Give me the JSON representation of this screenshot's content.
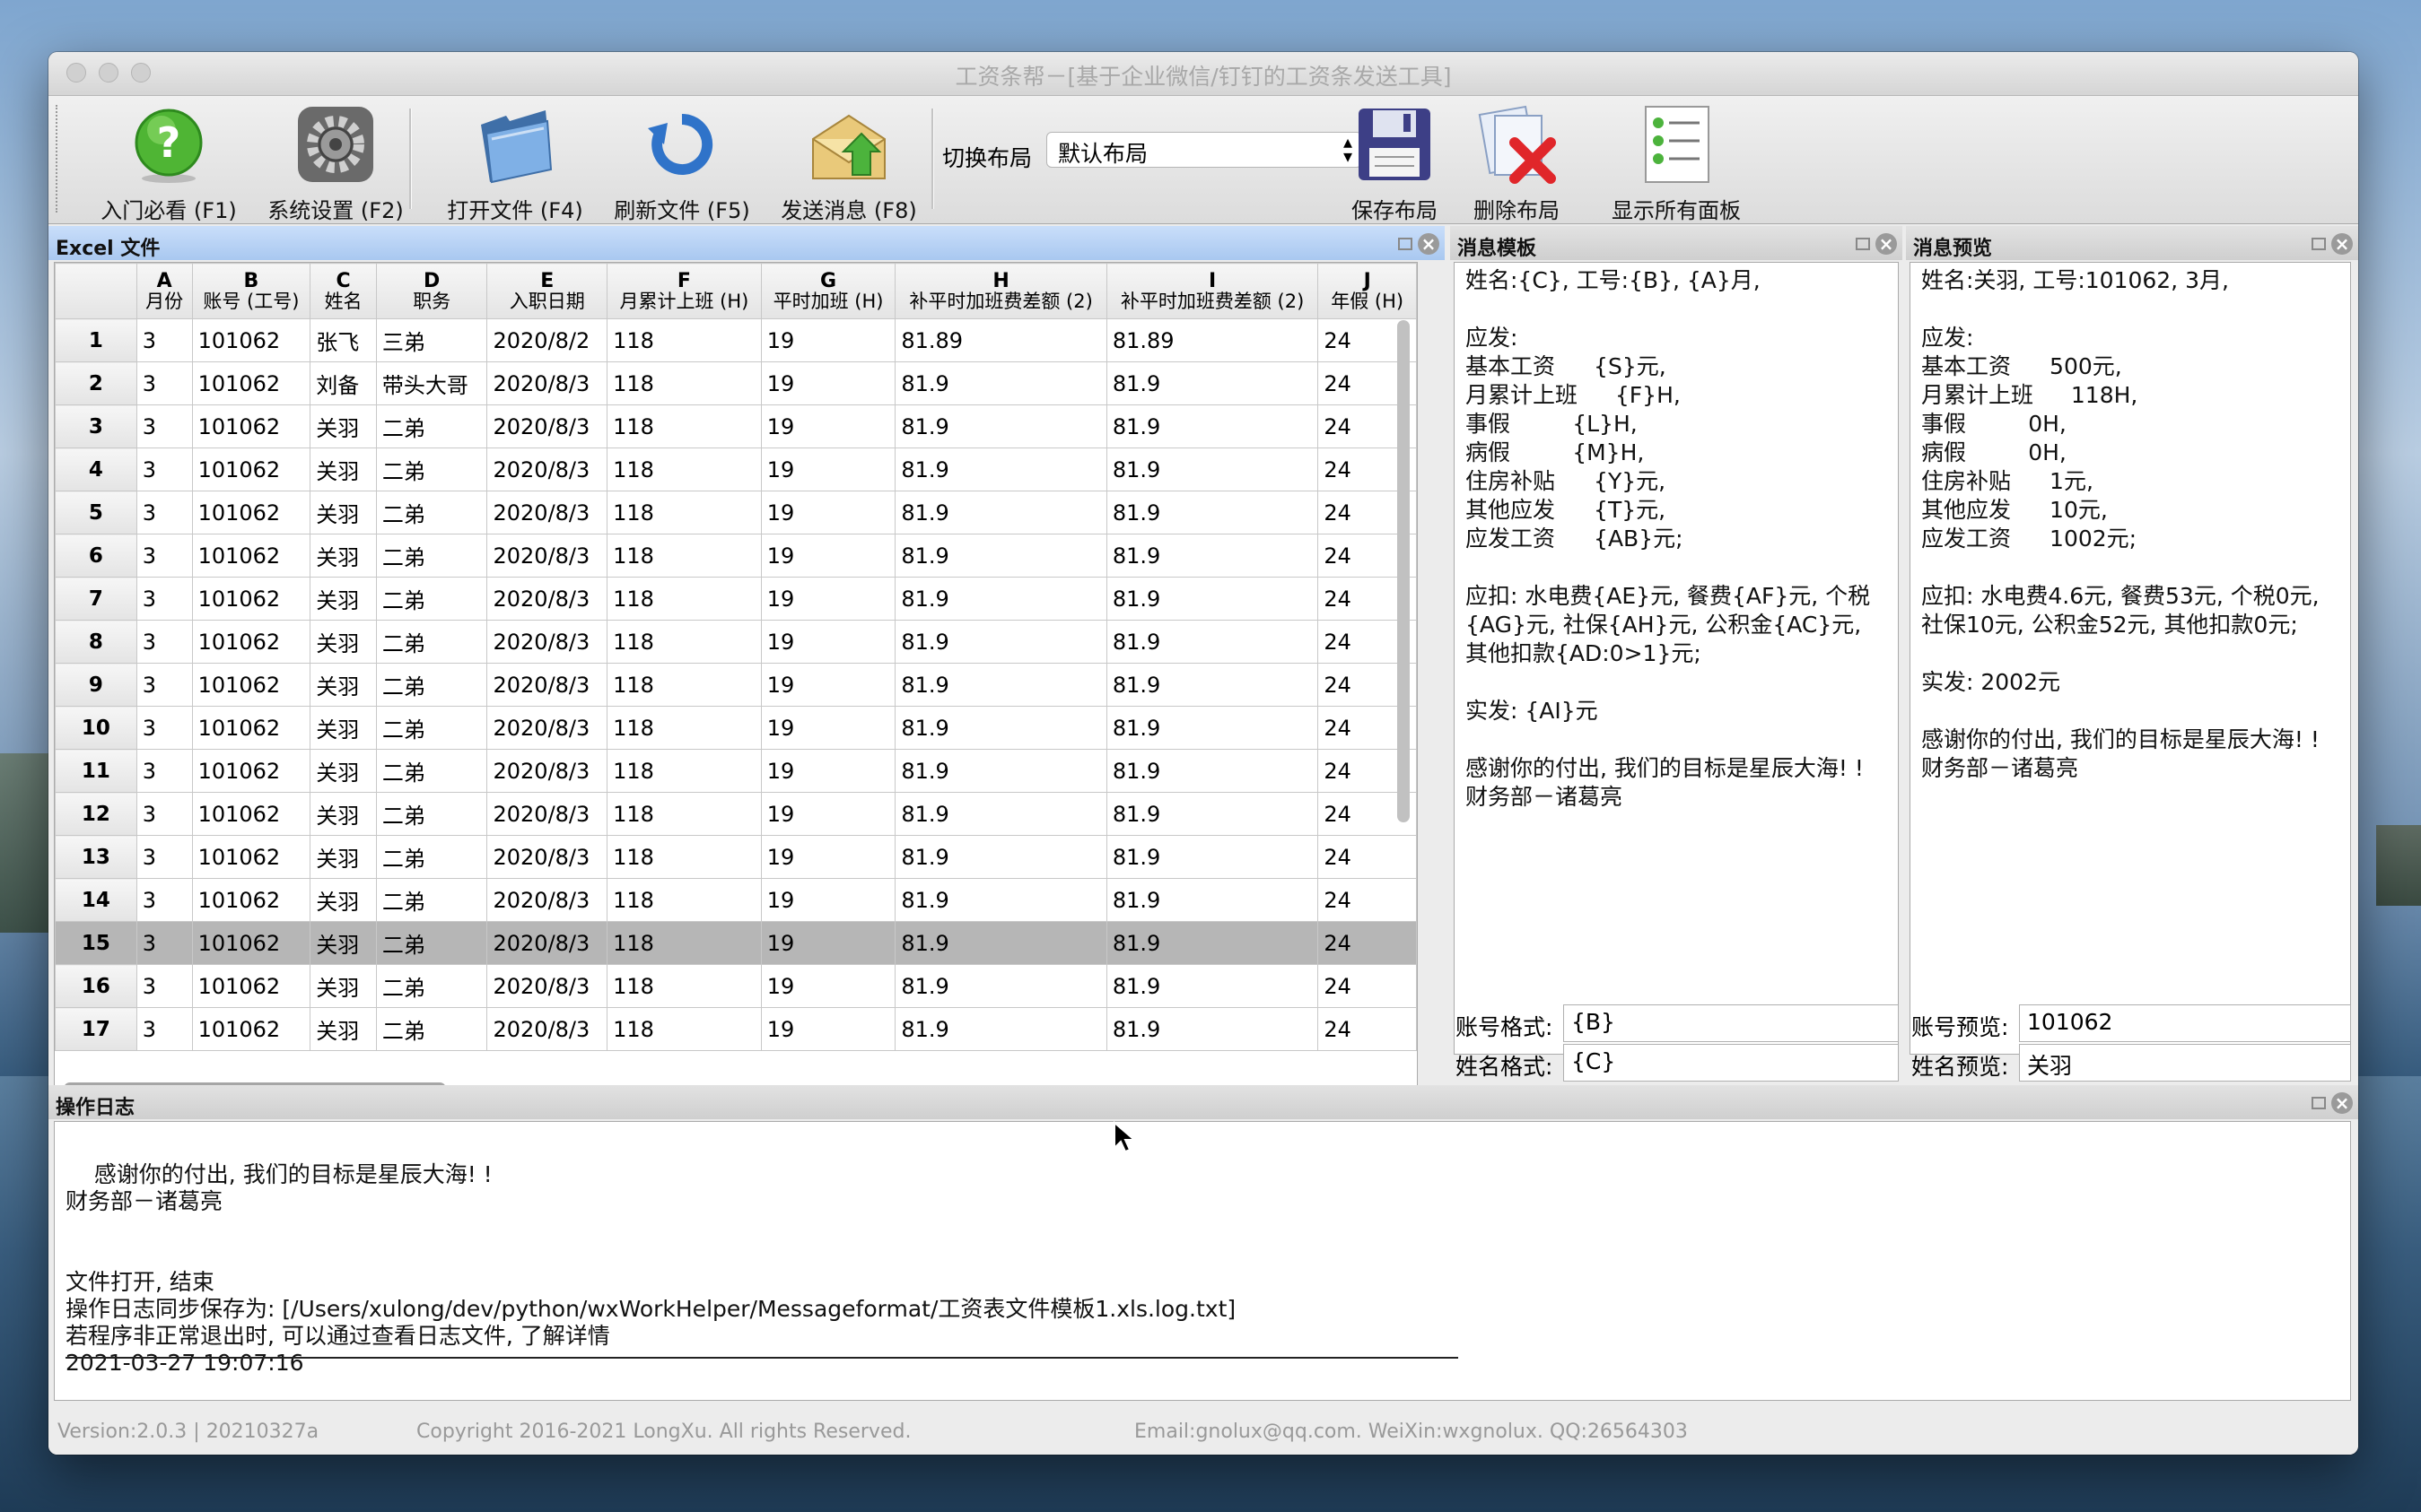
{
  "window": {
    "title": "工资条帮－[基于企业微信/钉钉的工资条发送工具]"
  },
  "toolbar": {
    "buttons": [
      {
        "label": "入门必看 (F1)",
        "icon": "help-question-icon"
      },
      {
        "label": "系统设置 (F2)",
        "icon": "gear-icon"
      },
      {
        "label": "打开文件 (F4)",
        "icon": "folder-icon"
      },
      {
        "label": "刷新文件 (F5)",
        "icon": "refresh-icon"
      },
      {
        "label": "发送消息 (F8)",
        "icon": "send-mail-icon"
      },
      {
        "label": "保存布局",
        "icon": "floppy-disk-icon"
      },
      {
        "label": "删除布局",
        "icon": "delete-documents-icon"
      },
      {
        "label": "显示所有面板",
        "icon": "checklist-icon"
      }
    ],
    "layout_label": "切换布局",
    "layout_value": "默认布局"
  },
  "excel": {
    "title": "Excel 文件",
    "columns": [
      {
        "letter": "A",
        "name": "月份"
      },
      {
        "letter": "B",
        "name": "账号 (工号)"
      },
      {
        "letter": "C",
        "name": "姓名"
      },
      {
        "letter": "D",
        "name": "职务"
      },
      {
        "letter": "E",
        "name": "入职日期"
      },
      {
        "letter": "F",
        "name": "月累计上班 (H)"
      },
      {
        "letter": "G",
        "name": "平时加班 (H)"
      },
      {
        "letter": "H",
        "name": "补平时加班费差额 (2)"
      },
      {
        "letter": "I",
        "name": "补平时加班费差额 (2)"
      },
      {
        "letter": "J",
        "name": "年假 (H)"
      }
    ],
    "rows": [
      {
        "n": "1",
        "c": [
          "3",
          "101062",
          "张飞",
          "三弟",
          "2020/8/2",
          "118",
          "19",
          "81.89",
          "81.89",
          "24"
        ]
      },
      {
        "n": "2",
        "c": [
          "3",
          "101062",
          "刘备",
          "带头大哥",
          "2020/8/3",
          "118",
          "19",
          "81.9",
          "81.9",
          "24"
        ]
      },
      {
        "n": "3",
        "c": [
          "3",
          "101062",
          "关羽",
          "二弟",
          "2020/8/3",
          "118",
          "19",
          "81.9",
          "81.9",
          "24"
        ]
      },
      {
        "n": "4",
        "c": [
          "3",
          "101062",
          "关羽",
          "二弟",
          "2020/8/3",
          "118",
          "19",
          "81.9",
          "81.9",
          "24"
        ]
      },
      {
        "n": "5",
        "c": [
          "3",
          "101062",
          "关羽",
          "二弟",
          "2020/8/3",
          "118",
          "19",
          "81.9",
          "81.9",
          "24"
        ]
      },
      {
        "n": "6",
        "c": [
          "3",
          "101062",
          "关羽",
          "二弟",
          "2020/8/3",
          "118",
          "19",
          "81.9",
          "81.9",
          "24"
        ]
      },
      {
        "n": "7",
        "c": [
          "3",
          "101062",
          "关羽",
          "二弟",
          "2020/8/3",
          "118",
          "19",
          "81.9",
          "81.9",
          "24"
        ]
      },
      {
        "n": "8",
        "c": [
          "3",
          "101062",
          "关羽",
          "二弟",
          "2020/8/3",
          "118",
          "19",
          "81.9",
          "81.9",
          "24"
        ]
      },
      {
        "n": "9",
        "c": [
          "3",
          "101062",
          "关羽",
          "二弟",
          "2020/8/3",
          "118",
          "19",
          "81.9",
          "81.9",
          "24"
        ]
      },
      {
        "n": "10",
        "c": [
          "3",
          "101062",
          "关羽",
          "二弟",
          "2020/8/3",
          "118",
          "19",
          "81.9",
          "81.9",
          "24"
        ]
      },
      {
        "n": "11",
        "c": [
          "3",
          "101062",
          "关羽",
          "二弟",
          "2020/8/3",
          "118",
          "19",
          "81.9",
          "81.9",
          "24"
        ]
      },
      {
        "n": "12",
        "c": [
          "3",
          "101062",
          "关羽",
          "二弟",
          "2020/8/3",
          "118",
          "19",
          "81.9",
          "81.9",
          "24"
        ]
      },
      {
        "n": "13",
        "c": [
          "3",
          "101062",
          "关羽",
          "二弟",
          "2020/8/3",
          "118",
          "19",
          "81.9",
          "81.9",
          "24"
        ]
      },
      {
        "n": "14",
        "c": [
          "3",
          "101062",
          "关羽",
          "二弟",
          "2020/8/3",
          "118",
          "19",
          "81.9",
          "81.9",
          "24"
        ]
      },
      {
        "n": "15",
        "c": [
          "3",
          "101062",
          "关羽",
          "二弟",
          "2020/8/3",
          "118",
          "19",
          "81.9",
          "81.9",
          "24"
        ],
        "selected": true
      },
      {
        "n": "16",
        "c": [
          "3",
          "101062",
          "关羽",
          "二弟",
          "2020/8/3",
          "118",
          "19",
          "81.9",
          "81.9",
          "24"
        ]
      },
      {
        "n": "17",
        "c": [
          "3",
          "101062",
          "关羽",
          "二弟",
          "2020/8/3",
          "118",
          "19",
          "81.9",
          "81.9",
          "24"
        ]
      }
    ]
  },
  "template": {
    "title": "消息模板",
    "text": "姓名:{C}, 工号:{B}, {A}月,\n\n应发:\n基本工资\t\t{S}元,\n月累计上班\t\t{F}H,\n事假\t\t\t{L}H,\n病假\t\t\t{M}H,\n住房补贴\t\t{Y}元,\n其他应发\t\t{T}元,\n应发工资\t\t{AB}元;\n\n应扣: 水电费{AE}元, 餐费{AF}元, 个税{AG}元, 社保{AH}元, 公积金{AC}元, 其他扣款{AD:0>1}元;\n\n实发: {AI}元\n\n感谢你的付出, 我们的目标是星辰大海! !\n财务部－诸葛亮",
    "account_label": "账号格式:",
    "account_value": "{B}",
    "name_label": "姓名格式:",
    "name_value": "{C}"
  },
  "preview": {
    "title": "消息预览",
    "text": "姓名:关羽, 工号:101062, 3月,\n\n应发:\n基本工资\t\t500元,\n月累计上班\t\t118H,\n事假\t\t\t0H,\n病假\t\t\t0H,\n住房补贴\t\t1元,\n其他应发\t\t10元,\n应发工资\t\t1002元;\n\n应扣: 水电费4.6元, 餐费53元, 个税0元, 社保10元, 公积金52元, 其他扣款0元;\n\n实发: 2002元\n\n感谢你的付出, 我们的目标是星辰大海! !\n财务部－诸葛亮",
    "account_label": "账号预览:",
    "account_value": "101062",
    "name_label": "姓名预览:",
    "name_value": "关羽"
  },
  "log": {
    "title": "操作日志",
    "text": "感谢你的付出, 我们的目标是星辰大海! !\n财务部－诸葛亮\n\n\n文件打开, 结束\n操作日志同步保存为: [/Users/xulong/dev/python/wxWorkHelper/Messageformat/工资表文件模板1.xls.log.txt]\n若程序非正常退出时, 可以通过查看日志文件, 了解详情\n2021-03-27 19:07:16"
  },
  "status": {
    "version": "Version:2.0.3 | 20210327a",
    "copyright": "Copyright 2016-2021 LongXu. All rights Reserved.",
    "contact": "Email:gnolux@qq.com.  WeiXin:wxgnolux. QQ:26564303"
  }
}
